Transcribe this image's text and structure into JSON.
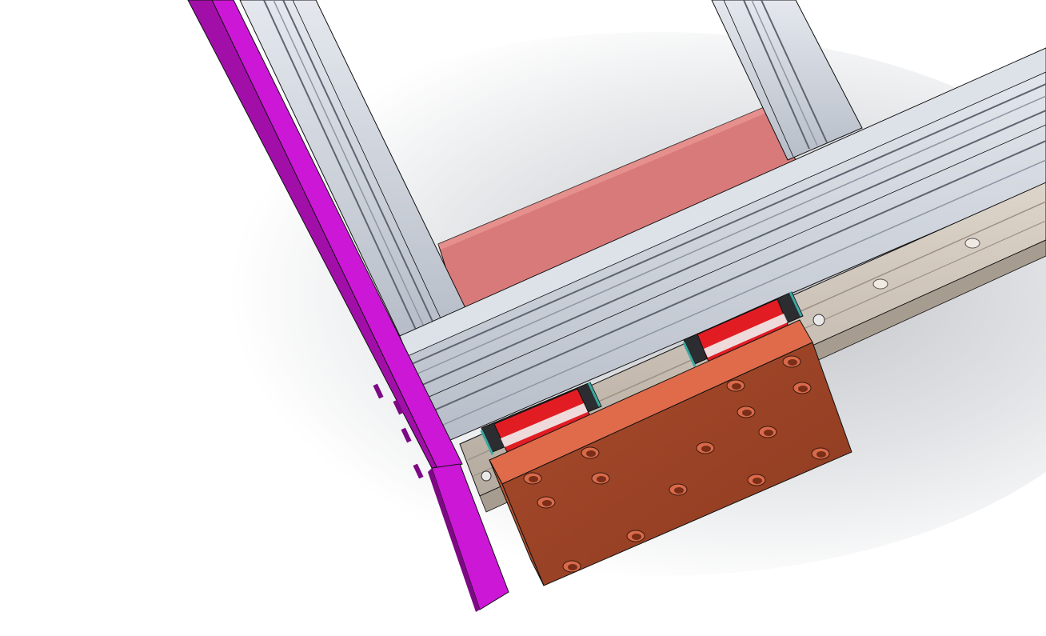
{
  "scene": {
    "kind": "cad-assembly-render",
    "shading": "shaded-with-edges",
    "background": "gradient-grey-white"
  },
  "colors": {
    "background_light": "#ffffff",
    "background_shadow": "#c8cace",
    "side_plate": "#cc17d6",
    "side_plate_shade": "#a10fa8",
    "side_plate_dark": "#7d0a84",
    "extrusion_face": "#c6ccd6",
    "extrusion_light": "#dde1e8",
    "extrusion_dark": "#8f96a3",
    "extrusion_groove": "#5f6570",
    "infill_panel": "#d97a7a",
    "infill_panel_light": "#ef9f9a",
    "linear_rail": "#d2c8bd",
    "rail_shade": "#b8ada1",
    "carriage_top": "#df6b4a",
    "carriage_face": "#9b4226",
    "carriage_edge": "#b6522f",
    "bearing_block": "#e11d23",
    "bearing_block_light": "#f0f0f0",
    "end_seal": "#2b2d30",
    "wiper_teal": "#3aa7a1",
    "edge_line": "#111111"
  },
  "parts": [
    {
      "id": "side-plate",
      "icon": "plate-icon"
    },
    {
      "id": "frame-extrusion-vertical-left",
      "icon": "extrusion-icon"
    },
    {
      "id": "frame-extrusion-vertical-right",
      "icon": "extrusion-icon"
    },
    {
      "id": "frame-extrusion-horizontal",
      "icon": "extrusion-icon"
    },
    {
      "id": "infill-panel",
      "icon": "panel-icon"
    },
    {
      "id": "linear-rail",
      "icon": "rail-icon"
    },
    {
      "id": "bearing-block-left",
      "icon": "bearing-block-icon"
    },
    {
      "id": "bearing-block-right",
      "icon": "bearing-block-icon"
    },
    {
      "id": "carriage-plate",
      "icon": "carriage-plate-icon"
    }
  ],
  "carriage_holes": 15,
  "rail_bolts": 3
}
